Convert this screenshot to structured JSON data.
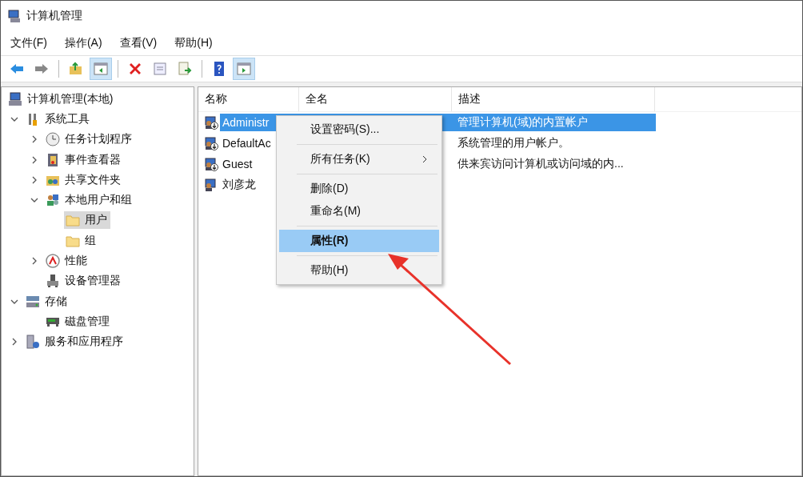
{
  "window": {
    "title": "计算机管理"
  },
  "menu_bar": [
    "文件(F)",
    "操作(A)",
    "查看(V)",
    "帮助(H)"
  ],
  "toolbar": [
    [
      {
        "kind": "back",
        "on": false
      },
      {
        "kind": "forward",
        "on": false
      }
    ],
    [
      {
        "kind": "up",
        "on": false
      },
      {
        "kind": "pane",
        "on": true
      }
    ],
    [
      {
        "kind": "delete",
        "on": false
      },
      {
        "kind": "properties",
        "on": false
      },
      {
        "kind": "export",
        "on": false
      }
    ],
    [
      {
        "kind": "help",
        "on": false
      },
      {
        "kind": "actionpane",
        "on": true
      }
    ]
  ],
  "tree": [
    {
      "label": "计算机管理(本地)",
      "kind": "computer",
      "selected": false,
      "children": [
        {
          "label": "系统工具",
          "kind": "tools",
          "expanded": true,
          "selected": false,
          "children": [
            {
              "label": "任务计划程序",
              "kind": "clock",
              "expanded": false,
              "selected": false
            },
            {
              "label": "事件查看器",
              "kind": "log",
              "expanded": false,
              "selected": false
            },
            {
              "label": "共享文件夹",
              "kind": "share",
              "expanded": false,
              "selected": false
            },
            {
              "label": "本地用户和组",
              "kind": "users",
              "expanded": true,
              "selected": false,
              "children": [
                {
                  "label": "用户",
                  "kind": "folder",
                  "selected": true
                },
                {
                  "label": "组",
                  "kind": "folder",
                  "selected": false
                }
              ]
            },
            {
              "label": "性能",
              "kind": "gauge",
              "expanded": false,
              "selected": false
            },
            {
              "label": "设备管理器",
              "kind": "device",
              "selected": false
            }
          ]
        },
        {
          "label": "存储",
          "kind": "storage",
          "expanded": true,
          "selected": false,
          "children": [
            {
              "label": "磁盘管理",
              "kind": "disk",
              "selected": false
            }
          ]
        },
        {
          "label": "服务和应用程序",
          "kind": "services",
          "expanded": false,
          "selected": false
        }
      ]
    }
  ],
  "table": {
    "columns": [
      "名称",
      "全名",
      "描述"
    ],
    "rows": [
      {
        "name": "Administr",
        "description": "管理计算机(域)的内置帐户",
        "disabled": true,
        "selected": true
      },
      {
        "name": "DefaultAc",
        "description": "系统管理的用户帐户。",
        "disabled": true,
        "selected": false
      },
      {
        "name": "Guest",
        "description": "供来宾访问计算机或访问域的内...",
        "disabled": true,
        "selected": false
      },
      {
        "name": "刘彦龙",
        "disabled": false,
        "selected": false
      }
    ]
  },
  "context_menu": [
    [
      {
        "label": "设置密码(S)...",
        "submenu": false,
        "default": false,
        "selected": false
      }
    ],
    [
      {
        "label": "所有任务(K)",
        "submenu": true,
        "default": false,
        "selected": false
      }
    ],
    [
      {
        "label": "删除(D)",
        "submenu": false,
        "default": false,
        "selected": false
      },
      {
        "label": "重命名(M)",
        "submenu": false,
        "default": false,
        "selected": false
      }
    ],
    [
      {
        "label": "属性(R)",
        "submenu": false,
        "default": true,
        "selected": true
      }
    ],
    [
      {
        "label": "帮助(H)",
        "submenu": false,
        "default": false,
        "selected": false
      }
    ]
  ]
}
